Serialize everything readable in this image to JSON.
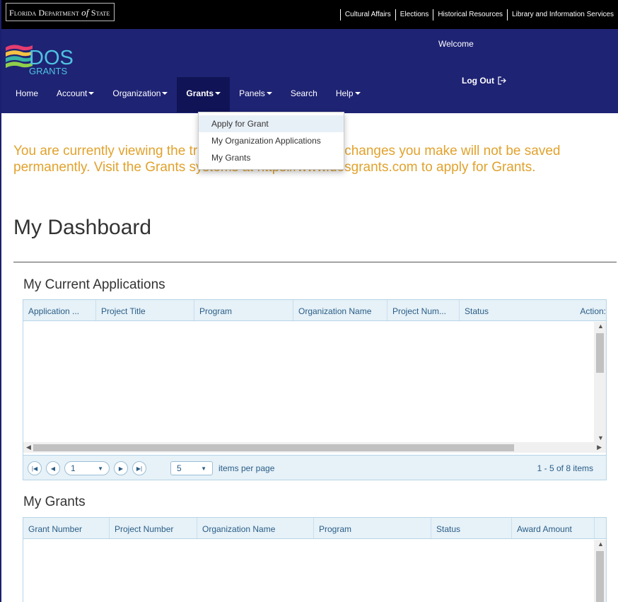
{
  "topbar": {
    "dept_prefix": "Florida Department ",
    "dept_of": "of",
    "dept_suffix": " State",
    "links": [
      "Cultural Affairs",
      "Elections",
      "Historical Resources",
      "Library and Information Services"
    ]
  },
  "header": {
    "logo_main": "DOS",
    "logo_sub": "GRANTS",
    "welcome": "Welcome",
    "logout": "Log Out",
    "nav": [
      {
        "label": "Home"
      },
      {
        "label": "Account"
      },
      {
        "label": "Organization"
      },
      {
        "label": "Grants"
      },
      {
        "label": "Panels"
      },
      {
        "label": "Search"
      },
      {
        "label": "Help"
      }
    ]
  },
  "dropdown": {
    "items": [
      "Apply for Grant",
      "My Organization Applications",
      "My Grants"
    ]
  },
  "notice": "You are currently viewing the training environment. Any changes you make will not be saved permanently. Visit the Grants systems at https://www.dosgrants.com to apply for Grants.",
  "page_title": "My Dashboard",
  "current_applications": {
    "title": "My Current Applications",
    "columns": [
      "Application ...",
      "Project Title",
      "Program",
      "Organization Name",
      "Project Num...",
      "Status",
      "Action:"
    ],
    "pager": {
      "page": "1",
      "page_size": "5",
      "items_per_page": "items per page",
      "summary": "1 - 5 of 8 items"
    }
  },
  "my_grants": {
    "title": "My Grants",
    "columns": [
      "Grant Number",
      "Project Number",
      "Organization Name",
      "Program",
      "Status",
      "Award Amount"
    ]
  },
  "colors": {
    "header_blue": "#1f2374",
    "notice_orange": "#e1a22d",
    "grid_header": "#e6f1f8"
  }
}
